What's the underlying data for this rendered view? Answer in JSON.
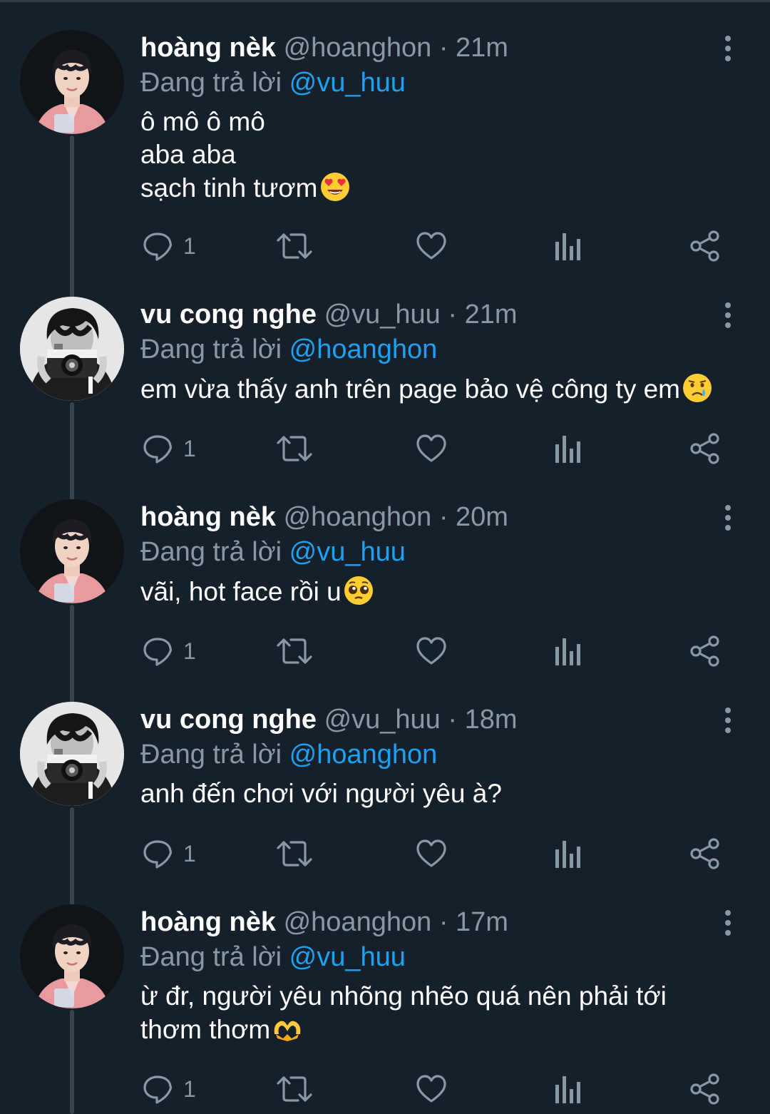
{
  "colors": {
    "background": "#15202b",
    "muted": "#8899a6",
    "link": "#1da1f2",
    "thread_line": "#38444d"
  },
  "reply_prefix": "Đang trả lời",
  "tweets": [
    {
      "name": "hoàng nèk",
      "handle": "@hoanghon",
      "separator": "·",
      "time": "21m",
      "reply_to": "@vu_huu",
      "text": "ô mô ô mô\naba aba\nsạch tinh tươm",
      "emoji": "smiling-face-with-heart-eyes",
      "avatar": "avatar-pink-shirt",
      "reply_count": "1"
    },
    {
      "name": "vu cong nghe",
      "handle": "@vu_huu",
      "separator": "·",
      "time": "21m",
      "reply_to": "@hoanghon",
      "text": "em vừa thấy anh trên page bảo vệ công ty em",
      "emoji": "crying-face",
      "avatar": "avatar-camera-bw",
      "reply_count": "1"
    },
    {
      "name": "hoàng nèk",
      "handle": "@hoanghon",
      "separator": "·",
      "time": "20m",
      "reply_to": "@vu_huu",
      "text": "vãi, hot face rồi u",
      "emoji": "pleading-face",
      "avatar": "avatar-pink-shirt",
      "reply_count": "1"
    },
    {
      "name": "vu cong nghe",
      "handle": "@vu_huu",
      "separator": "·",
      "time": "18m",
      "reply_to": "@hoanghon",
      "text": "anh đến chơi với người yêu à?",
      "emoji": "",
      "avatar": "avatar-camera-bw",
      "reply_count": "1"
    },
    {
      "name": "hoàng nèk",
      "handle": "@hoanghon",
      "separator": "·",
      "time": "17m",
      "reply_to": "@vu_huu",
      "text": "ừ đr, người yêu nhõng nhẽo quá nên phải tới\nthơm thơm",
      "emoji": "heart-hands",
      "avatar": "avatar-pink-shirt",
      "reply_count": "1"
    }
  ]
}
